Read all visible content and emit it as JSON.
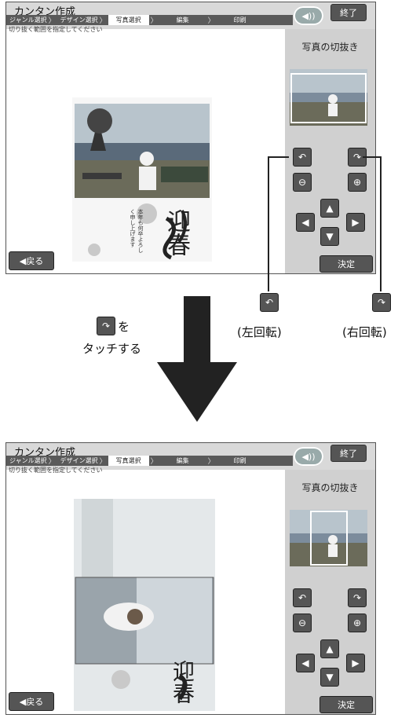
{
  "app_title": "カンタン作成",
  "steps": [
    "ジャンル選択",
    "デザイン選択",
    "写真選択",
    "編集",
    "印刷"
  ],
  "active_step": 2,
  "instruction": "切り抜く範囲を指定してください",
  "end_label": "終了",
  "speaker_icon": "speaker-icon",
  "panel_title": "写真の切抜き",
  "decide_label": "決定",
  "back_label": "◀戻る",
  "card_text": "本年も何卒よろしく申し上げます",
  "card_greeting": "迎春",
  "callouts": {
    "rotate_left_label": "(左回転)",
    "rotate_right_label": "(右回転)",
    "instruction_suffix": "を",
    "instruction_line2": "タッチする"
  },
  "colors": {
    "button": "#555555",
    "panel": "#d0d0d0",
    "topbar": "#d9d9d9"
  }
}
